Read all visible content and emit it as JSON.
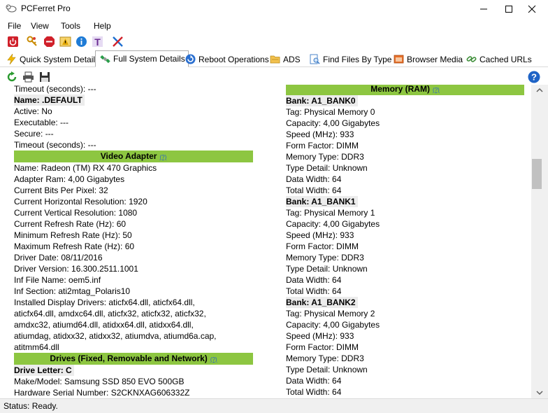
{
  "window": {
    "title": "PCFerret Pro"
  },
  "menu": [
    "File",
    "View",
    "Tools",
    "Help"
  ],
  "tabs": [
    {
      "label": "Quick System Details",
      "icon": "lightning-icon"
    },
    {
      "label": "Full System Details",
      "icon": "satellite-icon",
      "active": true
    },
    {
      "label": "Reboot Operations",
      "icon": "reboot-icon"
    },
    {
      "label": "ADS",
      "icon": "folder-icon"
    },
    {
      "label": "Find Files By Type",
      "icon": "find-files-icon"
    },
    {
      "label": "Browser Media",
      "icon": "browser-media-icon"
    },
    {
      "label": "Cached URLs",
      "icon": "link-icon"
    }
  ],
  "left": {
    "lines_top": [
      "Timeout (seconds): ---"
    ],
    "default_name": "Name: .DEFAULT",
    "default_lines": [
      "Active: No",
      "Executable: ---",
      "Secure: ---",
      "Timeout (seconds): ---"
    ],
    "video_header": "Video Adapter",
    "help_text": "(?)",
    "video_lines": [
      "Name: Radeon (TM) RX 470 Graphics",
      "Adapter Ram: 4,00 Gigabytes",
      "Current Bits Per Pixel: 32",
      "Current Horizontal Resolution: 1920",
      "Current Vertical Resolution: 1080",
      "Current Refresh Rate (Hz): 60",
      "Minimum Refresh Rate (Hz): 50",
      "Maximum Refresh Rate (Hz): 60",
      "Driver Date: 08/11/2016",
      "Driver Version: 16.300.2511.1001",
      "Inf File Name: oem5.inf",
      "Inf Section: ati2mtag_Polaris10",
      "Installed Display Drivers: aticfx64.dll, aticfx64.dll,",
      "aticfx64.dll, amdxc64.dll, aticfx32, aticfx32, aticfx32,",
      "amdxc32, atiumd64.dll, atidxx64.dll, atidxx64.dll,",
      "atiumdag, atidxx32, atidxx32, atiumdva, atiumd6a.cap,",
      "atitmm64.dll"
    ],
    "drives_header": "Drives (Fixed, Removable and Network)",
    "drive_letter": "Drive Letter: C",
    "drive_lines": [
      "Make/Model: Samsung SSD 850 EVO 500GB",
      "Hardware Serial Number: S2CKNXAG606332Z"
    ]
  },
  "right": {
    "memory_header": "Memory (RAM)",
    "help_text": "(?)",
    "banks": [
      {
        "name": "Bank: A1_BANK0",
        "lines": [
          "Tag: Physical Memory 0",
          "Capacity: 4,00 Gigabytes",
          "Speed (MHz): 933",
          "Form Factor: DIMM",
          "Memory Type: DDR3",
          "Type Detail: Unknown",
          "Data Width: 64",
          "Total Width: 64"
        ]
      },
      {
        "name": "Bank: A1_BANK1",
        "lines": [
          "Tag: Physical Memory 1",
          "Capacity: 4,00 Gigabytes",
          "Speed (MHz): 933",
          "Form Factor: DIMM",
          "Memory Type: DDR3",
          "Type Detail: Unknown",
          "Data Width: 64",
          "Total Width: 64"
        ]
      },
      {
        "name": "Bank: A1_BANK2",
        "lines": [
          "Tag: Physical Memory 2",
          "Capacity: 4,00 Gigabytes",
          "Speed (MHz): 933",
          "Form Factor: DIMM",
          "Memory Type: DDR3",
          "Type Detail: Unknown",
          "Data Width: 64",
          "Total Width: 64"
        ]
      }
    ]
  },
  "status": "Status: Ready.",
  "colors": {
    "section_header": "#8dc641",
    "help_link": "#2a64c4"
  }
}
